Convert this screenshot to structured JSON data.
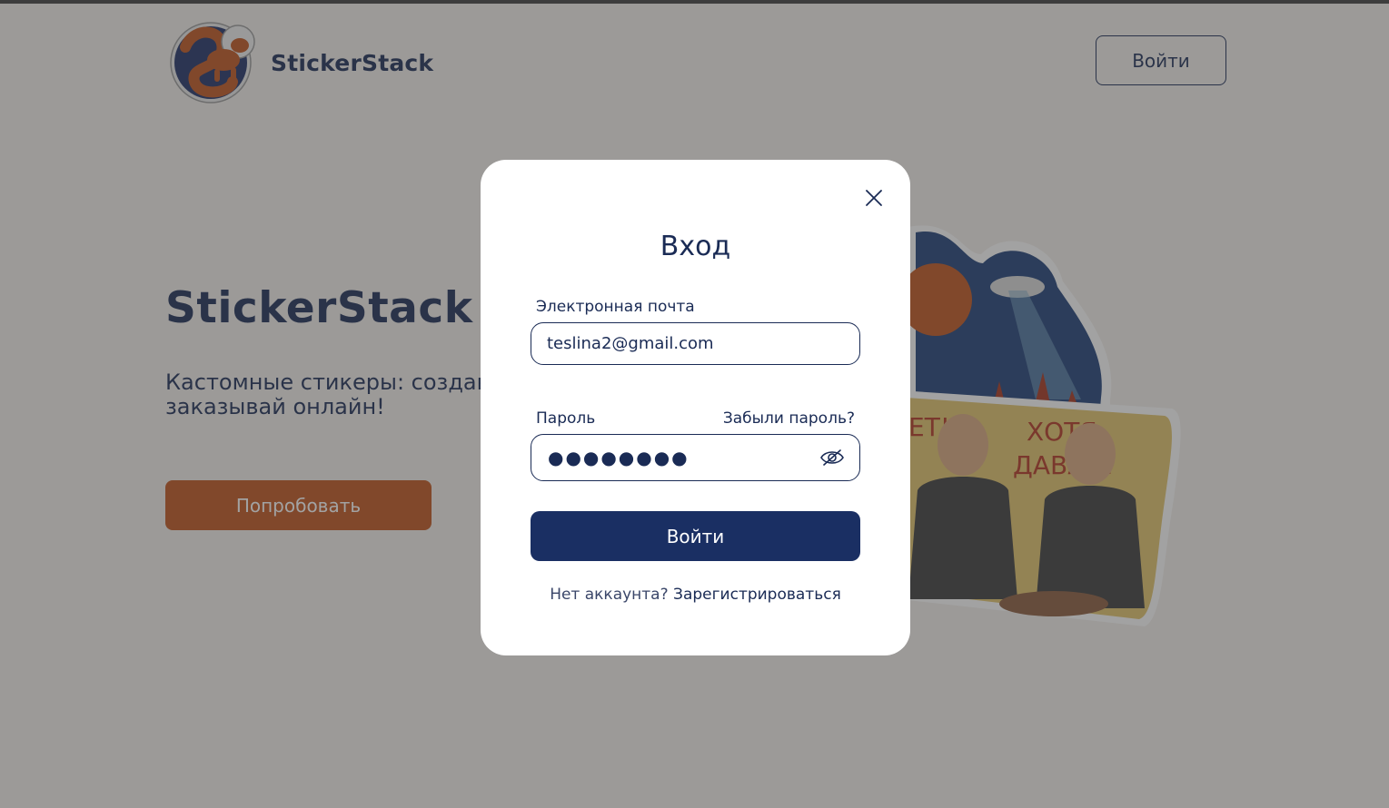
{
  "brand": {
    "name": "StickerStack",
    "logo_icon": "space-dog-logo-icon"
  },
  "header": {
    "login_label": "Войти"
  },
  "hero": {
    "title": "StickerStack",
    "subtitle": "Кастомные стикеры: создавай и заказывай онлайн!",
    "cta_label": "Попробовать"
  },
  "modal": {
    "title": "Вход",
    "close_icon": "close-icon",
    "email_label": "Электронная почта",
    "email_value": "teslina2@gmail.com",
    "password_label": "Пароль",
    "forgot_label": "Забыли пароль?",
    "password_value": "●●●●●●●●",
    "eye_icon": "eye-slash-icon",
    "submit_label": "Войти",
    "no_account_text": "Нет аккаунта?",
    "register_label": "Зарегистрироваться"
  },
  "stickers": {
    "sticker_1_text_a": "ХОТЯ",
    "sticker_1_text_b": "ДАВАЙ!",
    "sticker_1_text_c": "ЕТ!"
  },
  "colors": {
    "navy": "#1a2b55",
    "accent_orange": "#c0541c",
    "overlay": "rgba(60,60,60,0.48)"
  }
}
